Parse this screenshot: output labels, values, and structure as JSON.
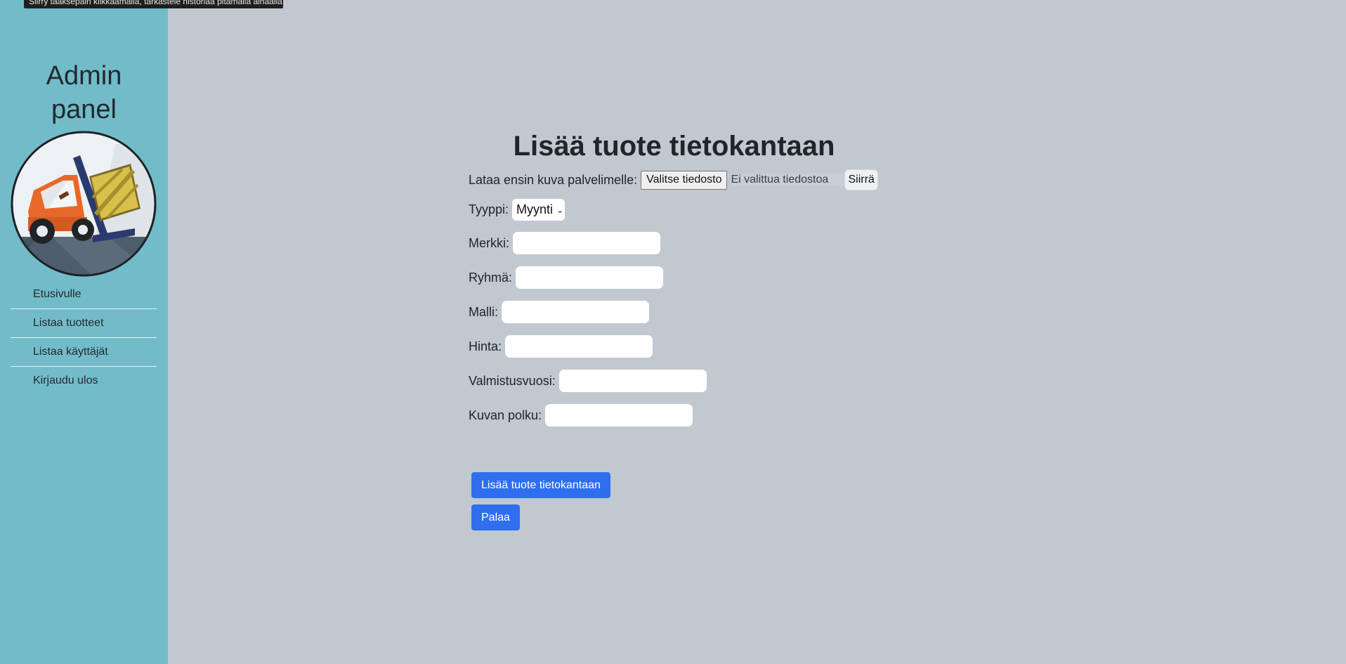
{
  "browser_tooltip": "Siirry taaksepäin klikkaamalla, tarkastele historiaa pitämällä alhaalla",
  "sidebar": {
    "title_line1": "Admin",
    "title_line2": "panel",
    "logo": "forklift-logo",
    "items": [
      {
        "label": "Etusivulle"
      },
      {
        "label": "Listaa tuotteet"
      },
      {
        "label": "Listaa käyttäjät"
      },
      {
        "label": "Kirjaudu ulos"
      }
    ]
  },
  "form": {
    "title": "Lisää tuote tietokantaan",
    "upload": {
      "label": "Lataa ensin kuva palvelimelle:",
      "choose_button": "Valitse tiedosto",
      "status": "Ei valittua tiedostoa",
      "submit": "Siirrä"
    },
    "type": {
      "label": "Tyyppi:",
      "selected": "Myynti"
    },
    "fields": {
      "merkki": {
        "label": "Merkki:",
        "value": ""
      },
      "ryhma": {
        "label": "Ryhmä:",
        "value": ""
      },
      "malli": {
        "label": "Malli:",
        "value": ""
      },
      "hinta": {
        "label": "Hinta:",
        "value": ""
      },
      "valmistusvuosi": {
        "label": "Valmistusvuosi:",
        "value": ""
      },
      "kuvan_polku": {
        "label": "Kuvan polku:",
        "value": ""
      }
    },
    "add_button": "Lisää tuote tietokantaan",
    "back_button": "Palaa"
  },
  "colors": {
    "sidebar_bg": "#72bcc9",
    "page_bg": "#c1c8d0",
    "primary": "#2f6fef"
  }
}
